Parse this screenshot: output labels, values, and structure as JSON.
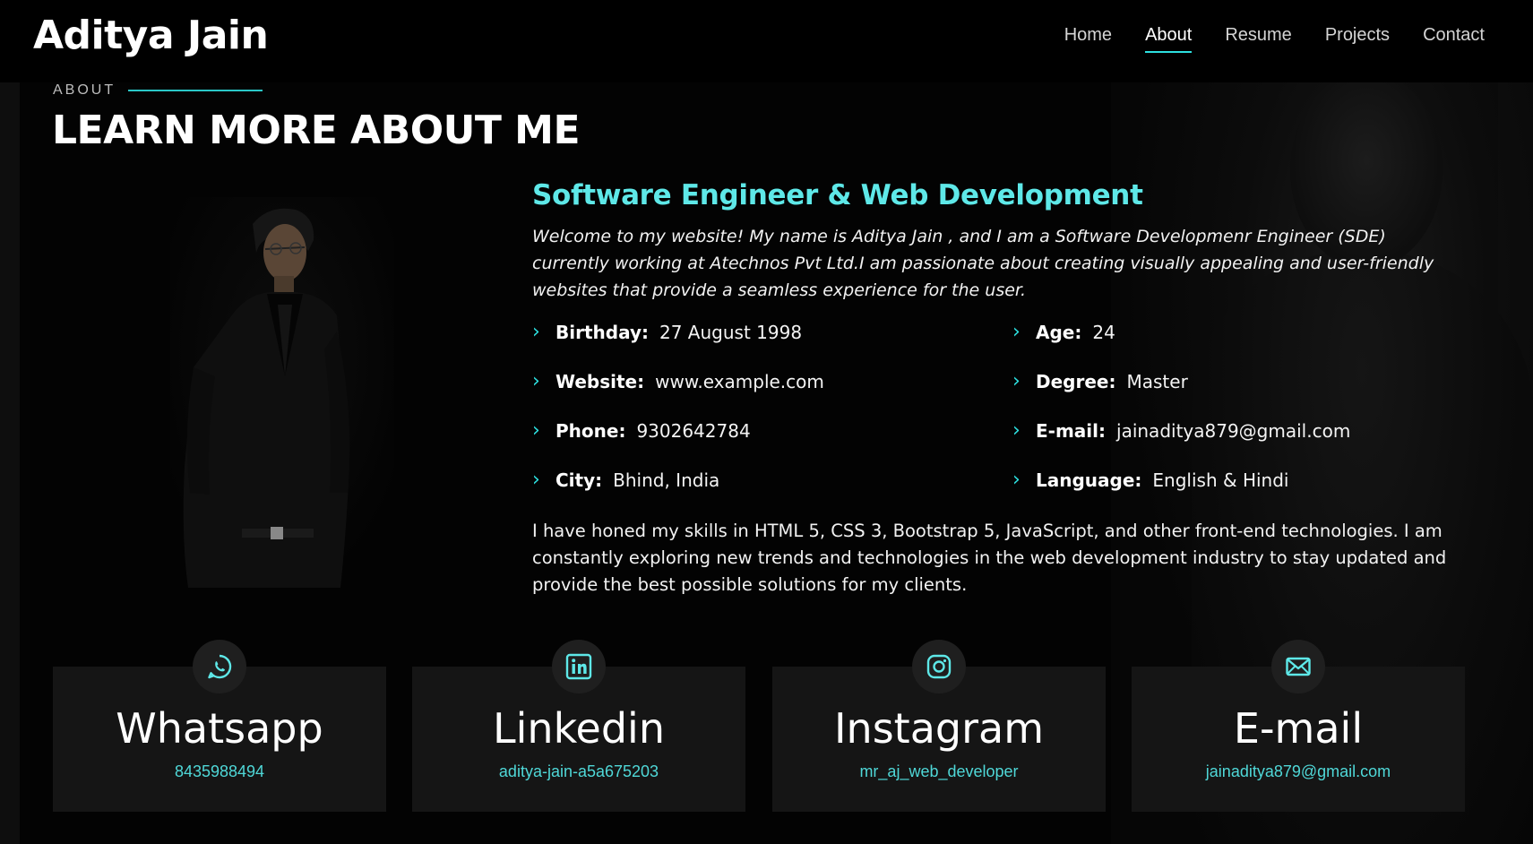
{
  "header": {
    "logo": "Aditya Jain",
    "nav": [
      "Home",
      "About",
      "Resume",
      "Projects",
      "Contact"
    ],
    "active": "About"
  },
  "section": {
    "tag": "ABOUT",
    "title": "LEARN MORE ABOUT ME"
  },
  "about": {
    "role": "Software Engineer & Web Development",
    "intro": "Welcome to my website! My name is Aditya Jain , and I am a Software Developmenr Engineer (SDE) currently working at Atechnos Pvt Ltd.I am passionate about creating visually appealing and user-friendly websites that provide a seamless experience for the user.",
    "facts": [
      {
        "label": "Birthday:",
        "value": "27 August 1998"
      },
      {
        "label": "Age:",
        "value": "24"
      },
      {
        "label": "Website:",
        "value": "www.example.com"
      },
      {
        "label": "Degree:",
        "value": "Master"
      },
      {
        "label": "Phone:",
        "value": "9302642784"
      },
      {
        "label": "E-mail:",
        "value": "jainaditya879@gmail.com"
      },
      {
        "label": "City:",
        "value": "Bhind, India"
      },
      {
        "label": "Language:",
        "value": "English & Hindi"
      }
    ],
    "outro": "I have honed my skills in HTML 5, CSS 3, Bootstrap 5, JavaScript, and other front-end technologies. I am constantly exploring new trends and technologies in the web development industry to stay updated and provide the best possible solutions for my clients."
  },
  "cards": [
    {
      "icon": "whatsapp-icon",
      "title": "Whatsapp",
      "sub": "8435988494"
    },
    {
      "icon": "linkedin-icon",
      "title": "Linkedin",
      "sub": "aditya-jain-a5a675203"
    },
    {
      "icon": "instagram-icon",
      "title": "Instagram",
      "sub": "mr_aj_web_developer"
    },
    {
      "icon": "mail-icon",
      "title": "E-mail",
      "sub": "jainaditya879@gmail.com"
    }
  ],
  "colors": {
    "accent": "#2de0e0",
    "role": "#5ee8e8",
    "card_bg": "#151515",
    "page_bg": "#040404"
  }
}
